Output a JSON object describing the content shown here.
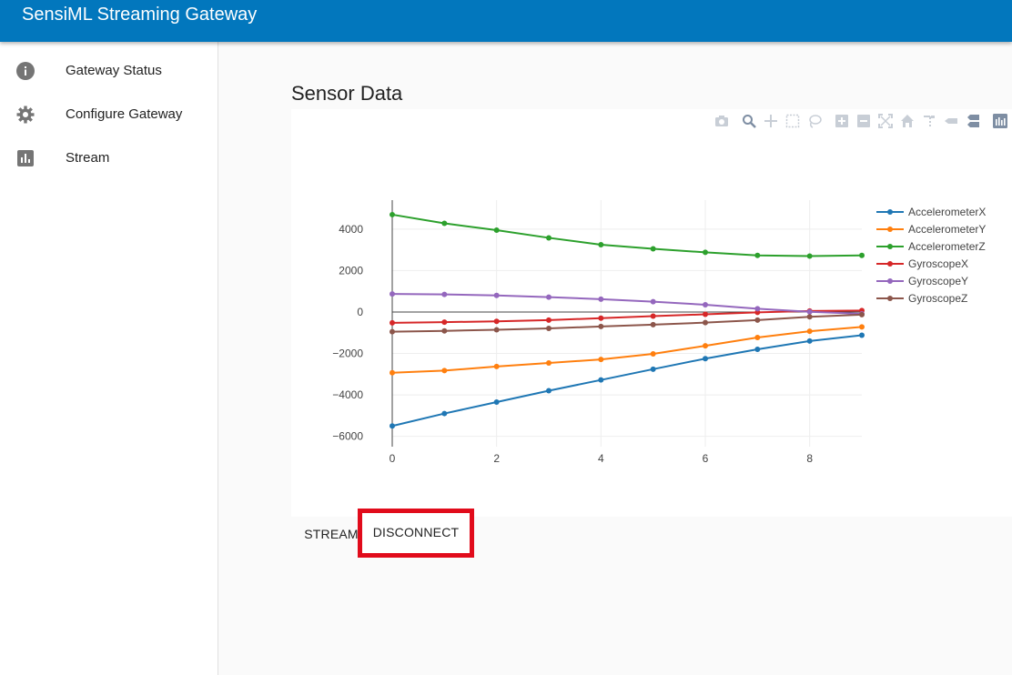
{
  "app": {
    "title": "SensiML Streaming Gateway"
  },
  "sidebar": {
    "items": [
      {
        "label": "Gateway Status",
        "icon": "info-icon"
      },
      {
        "label": "Configure Gateway",
        "icon": "gear-icon"
      },
      {
        "label": "Stream",
        "icon": "bar-chart-icon"
      }
    ]
  },
  "main": {
    "title": "Sensor Data"
  },
  "buttons": {
    "stream_label": "STREAM",
    "disconnect_label": "DISCONNECT"
  },
  "colors": {
    "appbar": "#0277bd",
    "highlight": "#e10b1b"
  },
  "modebar": [
    "camera-icon",
    "zoom-icon",
    "pan-icon",
    "box-select-icon",
    "lasso-icon",
    "zoom-in-icon",
    "zoom-out-icon",
    "autoscale-icon",
    "reset-axes-icon",
    "spike-lines-icon",
    "hover-closest-icon",
    "hover-compare-icon",
    "plotly-logo-icon"
  ],
  "chart_data": {
    "type": "line",
    "x": [
      0,
      1,
      2,
      3,
      4,
      5,
      6,
      7,
      8,
      9
    ],
    "xlim": [
      0,
      9
    ],
    "ylim": [
      -6500,
      5400
    ],
    "xticks": [
      0,
      2,
      4,
      6,
      8
    ],
    "yticks": [
      -6000,
      -4000,
      -2000,
      0,
      2000,
      4000
    ],
    "ytick_labels": [
      "−6000",
      "−4000",
      "−2000",
      "0",
      "2000",
      "4000"
    ],
    "grid": true,
    "legend_position": "right",
    "series": [
      {
        "name": "AccelerometerX",
        "color": "#1f77b4",
        "values": [
          -5500,
          -4900,
          -4350,
          -3800,
          -3280,
          -2760,
          -2250,
          -1800,
          -1400,
          -1120
        ]
      },
      {
        "name": "AccelerometerY",
        "color": "#ff7f0e",
        "values": [
          -2930,
          -2830,
          -2630,
          -2460,
          -2290,
          -2020,
          -1630,
          -1230,
          -930,
          -720
        ]
      },
      {
        "name": "AccelerometerZ",
        "color": "#2ca02c",
        "values": [
          4700,
          4280,
          3950,
          3580,
          3250,
          3050,
          2880,
          2730,
          2700,
          2730
        ]
      },
      {
        "name": "GyroscopeX",
        "color": "#d62728",
        "values": [
          -520,
          -490,
          -450,
          -390,
          -300,
          -200,
          -110,
          -20,
          50,
          70
        ]
      },
      {
        "name": "GyroscopeY",
        "color": "#9467bd",
        "values": [
          870,
          850,
          800,
          720,
          620,
          500,
          350,
          160,
          10,
          -90
        ]
      },
      {
        "name": "GyroscopeZ",
        "color": "#8c564b",
        "values": [
          -950,
          -910,
          -860,
          -790,
          -700,
          -610,
          -510,
          -390,
          -230,
          -130
        ]
      }
    ]
  }
}
